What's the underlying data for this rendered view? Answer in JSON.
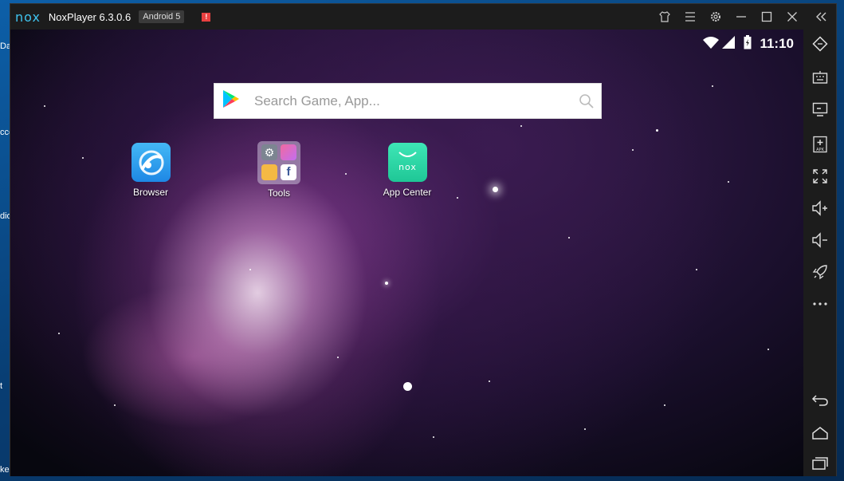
{
  "desktop": {
    "fragments": [
      "Das",
      "ccc",
      "dio",
      "t",
      "ke"
    ]
  },
  "titlebar": {
    "logo_text": "nox",
    "app_title": "NoxPlayer 6.3.0.6",
    "android_badge": "Android 5",
    "alert_badge": "!",
    "icons": [
      "shirt-icon",
      "menu-icon",
      "gear-icon",
      "minimize-icon",
      "maximize-icon",
      "close-icon",
      "collapse-icon"
    ]
  },
  "status_bar": {
    "clock": "11:10",
    "icons": [
      "wifi-icon",
      "signal-icon",
      "battery-icon"
    ]
  },
  "search": {
    "placeholder": "Search Game, App..."
  },
  "apps": [
    {
      "label": "Browser",
      "icon": "browser-icon",
      "color": "#2a9fe8"
    },
    {
      "label": "Tools",
      "icon": "tools-folder-icon",
      "color": "#8d7fa3"
    },
    {
      "label": "App Center",
      "icon": "app-center-icon",
      "color": "#2fd6a5"
    }
  ],
  "sidebar": {
    "icons": [
      "rotate-icon",
      "keyboard-icon",
      "screen-icon",
      "apk-icon",
      "fullscreen-icon",
      "volume-up-icon",
      "volume-down-icon",
      "rocket-icon",
      "more-icon",
      "back-icon",
      "home-icon",
      "recents-icon"
    ]
  },
  "colors": {
    "accent": "#3fc3ee",
    "window_bg": "#1c1c1c"
  }
}
